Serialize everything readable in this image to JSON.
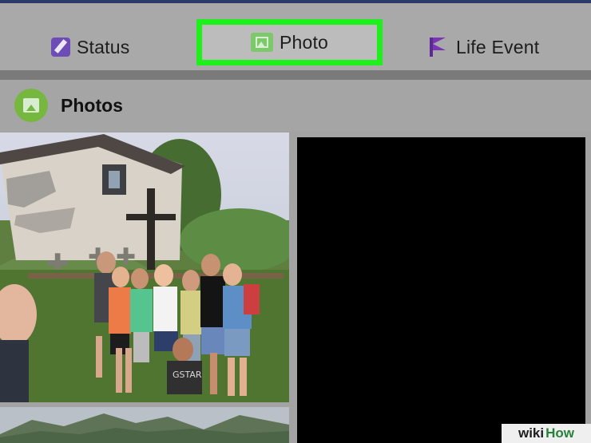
{
  "composer": {
    "status": "Status",
    "photo": "Photo",
    "life_event": "Life Event"
  },
  "photos": {
    "title": "Photos"
  },
  "watermark": {
    "prefix": "wiki",
    "suffix": "How"
  },
  "icons": {
    "status": "edit-icon",
    "photo": "photo-icon",
    "life_event": "flag-icon",
    "photos_header": "photos-icon"
  },
  "colors": {
    "highlight": "#1df01b",
    "status_icon": "#6d4cb8",
    "photo_icon": "#7cc86b",
    "life_event_icon": "#7a35b5"
  }
}
